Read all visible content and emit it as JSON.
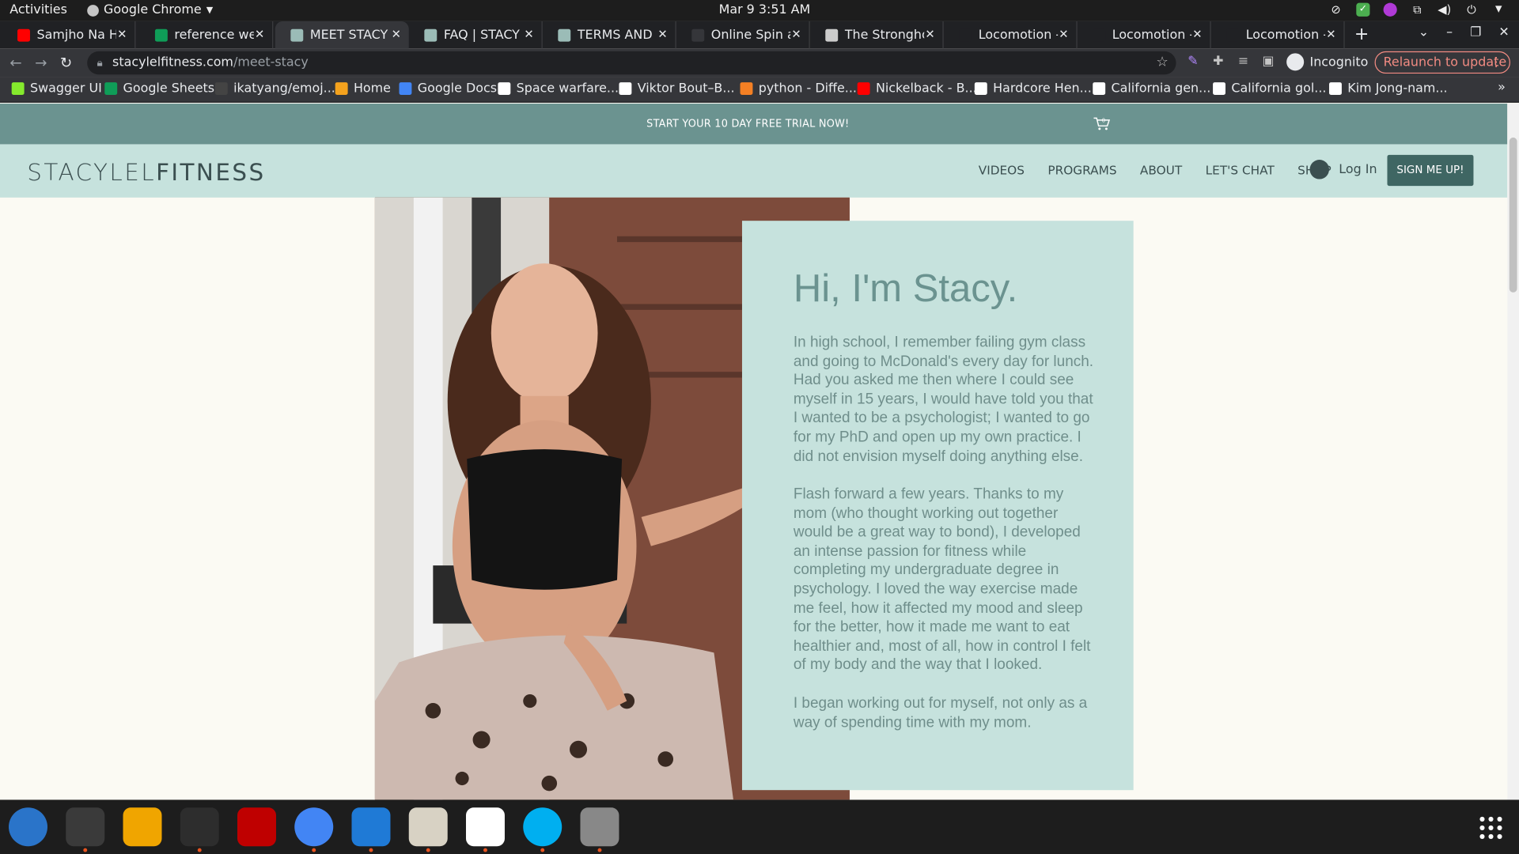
{
  "topbar": {
    "activities": "Activities",
    "app": "Google Chrome",
    "clock": "Mar 9  3:51 AM"
  },
  "tabs": [
    {
      "title": "Samjho Na H",
      "favicon_color": "#ff0000",
      "muted_icon": "speaker-icon"
    },
    {
      "title": "reference webs",
      "favicon_color": "#0f9d58"
    },
    {
      "title": "MEET STACY | S",
      "favicon_color": "#9bbcb7"
    },
    {
      "title": "FAQ | STACY LE",
      "favicon_color": "#9bbcb7"
    },
    {
      "title": "TERMS AND CO",
      "favicon_color": "#9bbcb7"
    },
    {
      "title": "Online Spin and",
      "favicon_color": "#35363a"
    },
    {
      "title": "The Stronghold",
      "favicon_color": "#cccccc"
    },
    {
      "title": "Locomotion - St",
      "favicon_color": "#202124"
    },
    {
      "title": "Locomotion - St",
      "favicon_color": "#202124"
    },
    {
      "title": "Locomotion - St",
      "favicon_color": "#202124"
    }
  ],
  "address": {
    "domain": "stacylelfitness.com",
    "path": "/meet-stacy",
    "incognito": "Incognito",
    "relaunch": "Relaunch to update"
  },
  "bookmarks": [
    {
      "label": "Swagger UI",
      "color": "#85ea2d"
    },
    {
      "label": "Google Sheets",
      "color": "#0f9d58"
    },
    {
      "label": "ikatyang/emoj...",
      "color": "#444444"
    },
    {
      "label": "Home",
      "color": "#f4a21d"
    },
    {
      "label": "Google Docs",
      "color": "#4285f4"
    },
    {
      "label": "Space warfare...",
      "color": "#ffffff"
    },
    {
      "label": "Viktor Bout–B...",
      "color": "#ffffff"
    },
    {
      "label": "python - Diffe...",
      "color": "#f48024"
    },
    {
      "label": "Nickelback - B...",
      "color": "#ff0000"
    },
    {
      "label": "Hardcore Hen...",
      "color": "#ffffff"
    },
    {
      "label": "California gen...",
      "color": "#ffffff"
    },
    {
      "label": "California gol...",
      "color": "#ffffff"
    },
    {
      "label": "Kim Jong-nam...",
      "color": "#ffffff"
    }
  ],
  "site": {
    "promo": "START YOUR 10 DAY FREE TRIAL NOW!",
    "cart_count": "0",
    "logo_light": "STACYLEL",
    "logo_bold": "FITNESS",
    "nav": [
      "VIDEOS",
      "PROGRAMS",
      "ABOUT",
      "LET'S CHAT",
      "SHOP"
    ],
    "login": "Log In",
    "cta": "SIGN ME UP!",
    "heading": "Hi, I'm Stacy.",
    "paragraphs": [
      "In high school, I remember failing gym class and going to McDonald's every day for lunch. Had you asked me then where I could see myself in 15 years, I would have told you that I wanted to be a psychologist; I wanted to go for my PhD and open up my own practice. I did not envision myself doing anything else.",
      "Flash forward a few years. Thanks to my mom (who thought working out together would be a great way to bond), I developed an intense passion for fitness while completing my undergraduate degree in psychology. I loved the way exercise made me feel, how it affected my mood and sleep for the better, how it made me want to eat healthier and, most of all, how in control I felt of my body and the way that I looked.",
      "I began working out for myself, not only as a way of spending time with my mom."
    ]
  },
  "dock": [
    {
      "name": "thunderbird-icon",
      "color": "#2a74c9"
    },
    {
      "name": "terminal-icon",
      "color": "#3a3a3a"
    },
    {
      "name": "calculator-icon",
      "color": "#f0a500"
    },
    {
      "name": "system-monitor-icon",
      "color": "#2d2d2d"
    },
    {
      "name": "filezilla-icon",
      "color": "#bf0000"
    },
    {
      "name": "chrome-icon",
      "color": "#4285f4"
    },
    {
      "name": "vscode-icon",
      "color": "#1f7ad6"
    },
    {
      "name": "files-icon",
      "color": "#d8d2c4"
    },
    {
      "name": "text-editor-icon",
      "color": "#ffffff"
    },
    {
      "name": "skype-icon",
      "color": "#00aff0"
    },
    {
      "name": "disk-icon",
      "color": "#888888"
    }
  ]
}
